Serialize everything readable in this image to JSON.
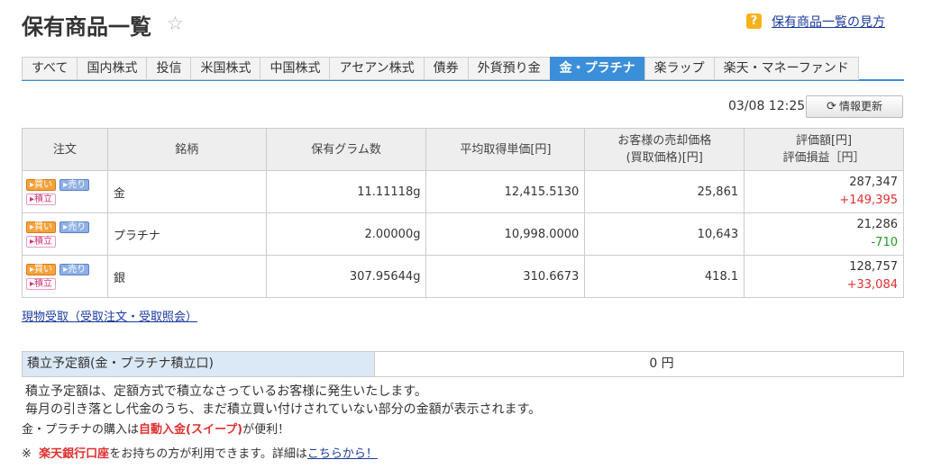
{
  "page": {
    "title": "保有商品一覧",
    "help_icon": "?",
    "help_link": "保有商品一覧の見方"
  },
  "tabs": [
    {
      "label": "すべて"
    },
    {
      "label": "国内株式"
    },
    {
      "label": "投信"
    },
    {
      "label": "米国株式"
    },
    {
      "label": "中国株式"
    },
    {
      "label": "アセアン株式"
    },
    {
      "label": "債券"
    },
    {
      "label": "外貨預り金"
    },
    {
      "label": "金・プラチナ",
      "active": true
    },
    {
      "label": "楽ラップ"
    },
    {
      "label": "楽天・マネーファンド"
    }
  ],
  "toolbar": {
    "timestamp": "03/08 12:25",
    "refresh_label": "情報更新"
  },
  "table": {
    "headers": {
      "order": "注文",
      "name": "銘柄",
      "grams": "保有グラム数",
      "avg_price": "平均取得単価[円]",
      "sell_price_1": "お客様の売却価格",
      "sell_price_2": "(買取価格)[円]",
      "value_1": "評価額[円]",
      "value_2": "評価損益［円］"
    },
    "order_buttons": {
      "buy": "▸買い",
      "sell": "▸売り",
      "tsumitate": "▸積立"
    },
    "rows": [
      {
        "name": "金",
        "grams": "11.11118g",
        "avg_price": "12,415.5130",
        "sell_price": "25,861",
        "value": "287,347",
        "pl": "+149,395",
        "pl_sign": "pos"
      },
      {
        "name": "プラチナ",
        "grams": "2.00000g",
        "avg_price": "10,998.0000",
        "sell_price": "10,643",
        "value": "21,286",
        "pl": "-710",
        "pl_sign": "neg"
      },
      {
        "name": "銀",
        "grams": "307.95644g",
        "avg_price": "310.6673",
        "sell_price": "418.1",
        "value": "128,757",
        "pl": "+33,084",
        "pl_sign": "pos"
      }
    ]
  },
  "receive_link": "現物受取（受取注文・受取照会）",
  "plan": {
    "label": "積立予定額(金・プラチナ積立口)",
    "value": "0 円"
  },
  "notes": {
    "line1": "積立予定額は、定額方式で積立なさっているお客様に発生いたします。",
    "line2": "毎月の引き落とし代金のうち、まだ積立買い付けされていない部分の金額が表示されます。",
    "line3_pre": "金・プラチナの購入は",
    "line3_red": "自動入金(スイープ)",
    "line3_post": "が便利！",
    "line4_mark": "※",
    "line4_red": "楽天銀行口座",
    "line4_mid": "をお持ちの方が利用できます。詳細は",
    "line4_link": "こちらから！"
  },
  "colors": {
    "accent": "#3b8fd9",
    "positive": "#e03030",
    "negative": "#1f9a1f",
    "link": "#1a3a9c"
  }
}
